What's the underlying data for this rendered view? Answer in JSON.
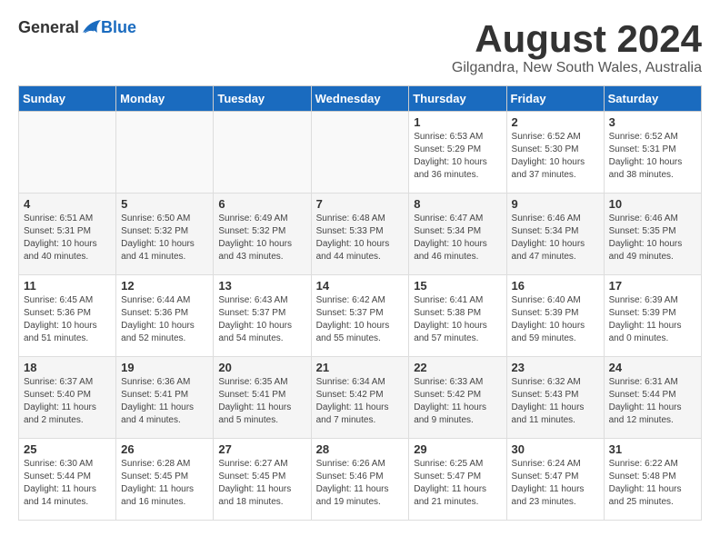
{
  "logo": {
    "general": "General",
    "blue": "Blue"
  },
  "title": "August 2024",
  "location": "Gilgandra, New South Wales, Australia",
  "headers": [
    "Sunday",
    "Monday",
    "Tuesday",
    "Wednesday",
    "Thursday",
    "Friday",
    "Saturday"
  ],
  "weeks": [
    [
      {
        "day": "",
        "info": ""
      },
      {
        "day": "",
        "info": ""
      },
      {
        "day": "",
        "info": ""
      },
      {
        "day": "",
        "info": ""
      },
      {
        "day": "1",
        "info": "Sunrise: 6:53 AM\nSunset: 5:29 PM\nDaylight: 10 hours\nand 36 minutes."
      },
      {
        "day": "2",
        "info": "Sunrise: 6:52 AM\nSunset: 5:30 PM\nDaylight: 10 hours\nand 37 minutes."
      },
      {
        "day": "3",
        "info": "Sunrise: 6:52 AM\nSunset: 5:31 PM\nDaylight: 10 hours\nand 38 minutes."
      }
    ],
    [
      {
        "day": "4",
        "info": "Sunrise: 6:51 AM\nSunset: 5:31 PM\nDaylight: 10 hours\nand 40 minutes."
      },
      {
        "day": "5",
        "info": "Sunrise: 6:50 AM\nSunset: 5:32 PM\nDaylight: 10 hours\nand 41 minutes."
      },
      {
        "day": "6",
        "info": "Sunrise: 6:49 AM\nSunset: 5:32 PM\nDaylight: 10 hours\nand 43 minutes."
      },
      {
        "day": "7",
        "info": "Sunrise: 6:48 AM\nSunset: 5:33 PM\nDaylight: 10 hours\nand 44 minutes."
      },
      {
        "day": "8",
        "info": "Sunrise: 6:47 AM\nSunset: 5:34 PM\nDaylight: 10 hours\nand 46 minutes."
      },
      {
        "day": "9",
        "info": "Sunrise: 6:46 AM\nSunset: 5:34 PM\nDaylight: 10 hours\nand 47 minutes."
      },
      {
        "day": "10",
        "info": "Sunrise: 6:46 AM\nSunset: 5:35 PM\nDaylight: 10 hours\nand 49 minutes."
      }
    ],
    [
      {
        "day": "11",
        "info": "Sunrise: 6:45 AM\nSunset: 5:36 PM\nDaylight: 10 hours\nand 51 minutes."
      },
      {
        "day": "12",
        "info": "Sunrise: 6:44 AM\nSunset: 5:36 PM\nDaylight: 10 hours\nand 52 minutes."
      },
      {
        "day": "13",
        "info": "Sunrise: 6:43 AM\nSunset: 5:37 PM\nDaylight: 10 hours\nand 54 minutes."
      },
      {
        "day": "14",
        "info": "Sunrise: 6:42 AM\nSunset: 5:37 PM\nDaylight: 10 hours\nand 55 minutes."
      },
      {
        "day": "15",
        "info": "Sunrise: 6:41 AM\nSunset: 5:38 PM\nDaylight: 10 hours\nand 57 minutes."
      },
      {
        "day": "16",
        "info": "Sunrise: 6:40 AM\nSunset: 5:39 PM\nDaylight: 10 hours\nand 59 minutes."
      },
      {
        "day": "17",
        "info": "Sunrise: 6:39 AM\nSunset: 5:39 PM\nDaylight: 11 hours\nand 0 minutes."
      }
    ],
    [
      {
        "day": "18",
        "info": "Sunrise: 6:37 AM\nSunset: 5:40 PM\nDaylight: 11 hours\nand 2 minutes."
      },
      {
        "day": "19",
        "info": "Sunrise: 6:36 AM\nSunset: 5:41 PM\nDaylight: 11 hours\nand 4 minutes."
      },
      {
        "day": "20",
        "info": "Sunrise: 6:35 AM\nSunset: 5:41 PM\nDaylight: 11 hours\nand 5 minutes."
      },
      {
        "day": "21",
        "info": "Sunrise: 6:34 AM\nSunset: 5:42 PM\nDaylight: 11 hours\nand 7 minutes."
      },
      {
        "day": "22",
        "info": "Sunrise: 6:33 AM\nSunset: 5:42 PM\nDaylight: 11 hours\nand 9 minutes."
      },
      {
        "day": "23",
        "info": "Sunrise: 6:32 AM\nSunset: 5:43 PM\nDaylight: 11 hours\nand 11 minutes."
      },
      {
        "day": "24",
        "info": "Sunrise: 6:31 AM\nSunset: 5:44 PM\nDaylight: 11 hours\nand 12 minutes."
      }
    ],
    [
      {
        "day": "25",
        "info": "Sunrise: 6:30 AM\nSunset: 5:44 PM\nDaylight: 11 hours\nand 14 minutes."
      },
      {
        "day": "26",
        "info": "Sunrise: 6:28 AM\nSunset: 5:45 PM\nDaylight: 11 hours\nand 16 minutes."
      },
      {
        "day": "27",
        "info": "Sunrise: 6:27 AM\nSunset: 5:45 PM\nDaylight: 11 hours\nand 18 minutes."
      },
      {
        "day": "28",
        "info": "Sunrise: 6:26 AM\nSunset: 5:46 PM\nDaylight: 11 hours\nand 19 minutes."
      },
      {
        "day": "29",
        "info": "Sunrise: 6:25 AM\nSunset: 5:47 PM\nDaylight: 11 hours\nand 21 minutes."
      },
      {
        "day": "30",
        "info": "Sunrise: 6:24 AM\nSunset: 5:47 PM\nDaylight: 11 hours\nand 23 minutes."
      },
      {
        "day": "31",
        "info": "Sunrise: 6:22 AM\nSunset: 5:48 PM\nDaylight: 11 hours\nand 25 minutes."
      }
    ]
  ]
}
